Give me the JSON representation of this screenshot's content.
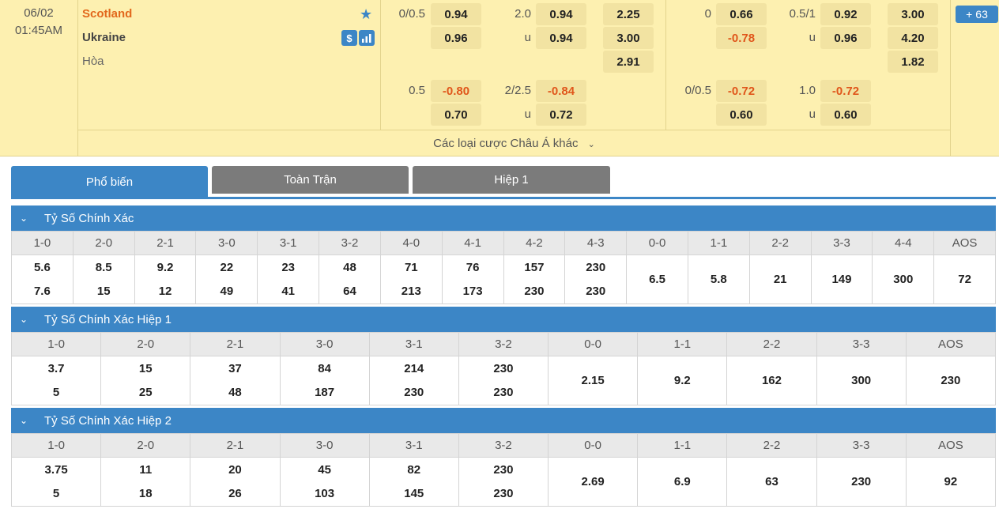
{
  "match": {
    "date": "06/02",
    "time": "01:45AM",
    "home": "Scotland",
    "away": "Ukraine",
    "draw": "Hòa",
    "icons": {
      "favorite": "star-icon",
      "money": "dollar-icon",
      "stats": "bar-chart-icon"
    },
    "ft": {
      "hdp_line": "0/0.5",
      "hdp_home": "0.94",
      "hdp_away": "0.96",
      "ou_line": "2.0",
      "ou_over": "0.94",
      "ou_u": "u",
      "ou_under": "0.94",
      "x12_home": "2.25",
      "x12_away": "3.00",
      "x12_draw": "2.91",
      "hdp2_line": "0.5",
      "hdp2_home": "-0.80",
      "hdp2_away": "0.70",
      "ou2_line": "2/2.5",
      "ou2_over": "-0.84",
      "ou2_u": "u",
      "ou2_under": "0.72"
    },
    "ht": {
      "hdp_line": "0",
      "hdp_home": "0.66",
      "hdp_away": "-0.78",
      "ou_line": "0.5/1",
      "ou_over": "0.92",
      "ou_u": "u",
      "ou_under": "0.96",
      "x12_home": "3.00",
      "x12_away": "4.20",
      "x12_draw": "1.82",
      "hdp2_line": "0/0.5",
      "hdp2_home": "-0.72",
      "hdp2_away": "0.60",
      "ou2_line": "1.0",
      "ou2_over": "-0.72",
      "ou2_u": "u",
      "ou2_under": "0.60"
    },
    "more_markets": "Các loại cược Châu Á khác",
    "count": "63"
  },
  "tabs": [
    "Phổ biến",
    "Toàn Trận",
    "Hiệp 1"
  ],
  "sections": [
    {
      "title": "Tỷ Số Chính Xác",
      "headers": [
        "1-0",
        "2-0",
        "2-1",
        "3-0",
        "3-1",
        "3-2",
        "4-0",
        "4-1",
        "4-2",
        "4-3",
        "0-0",
        "1-1",
        "2-2",
        "3-3",
        "4-4",
        "AOS"
      ],
      "top": [
        "5.6",
        "8.5",
        "9.2",
        "22",
        "23",
        "48",
        "71",
        "76",
        "157",
        "230"
      ],
      "bottom": [
        "7.6",
        "15",
        "12",
        "49",
        "41",
        "64",
        "213",
        "173",
        "230",
        "230"
      ],
      "single": [
        "6.5",
        "5.8",
        "21",
        "149",
        "300",
        "72"
      ]
    },
    {
      "title": "Tỷ Số Chính Xác Hiệp 1",
      "headers": [
        "1-0",
        "2-0",
        "2-1",
        "3-0",
        "3-1",
        "3-2",
        "0-0",
        "1-1",
        "2-2",
        "3-3",
        "AOS"
      ],
      "top": [
        "3.7",
        "15",
        "37",
        "84",
        "214",
        "230"
      ],
      "bottom": [
        "5",
        "25",
        "48",
        "187",
        "230",
        "230"
      ],
      "single": [
        "2.15",
        "9.2",
        "162",
        "300",
        "230"
      ]
    },
    {
      "title": "Tỷ Số Chính Xác Hiệp 2",
      "headers": [
        "1-0",
        "2-0",
        "2-1",
        "3-0",
        "3-1",
        "3-2",
        "0-0",
        "1-1",
        "2-2",
        "3-3",
        "AOS"
      ],
      "top": [
        "3.75",
        "11",
        "20",
        "45",
        "82",
        "230"
      ],
      "bottom": [
        "5",
        "18",
        "26",
        "103",
        "145",
        "230"
      ],
      "single": [
        "2.69",
        "6.9",
        "63",
        "230",
        "92"
      ]
    }
  ]
}
